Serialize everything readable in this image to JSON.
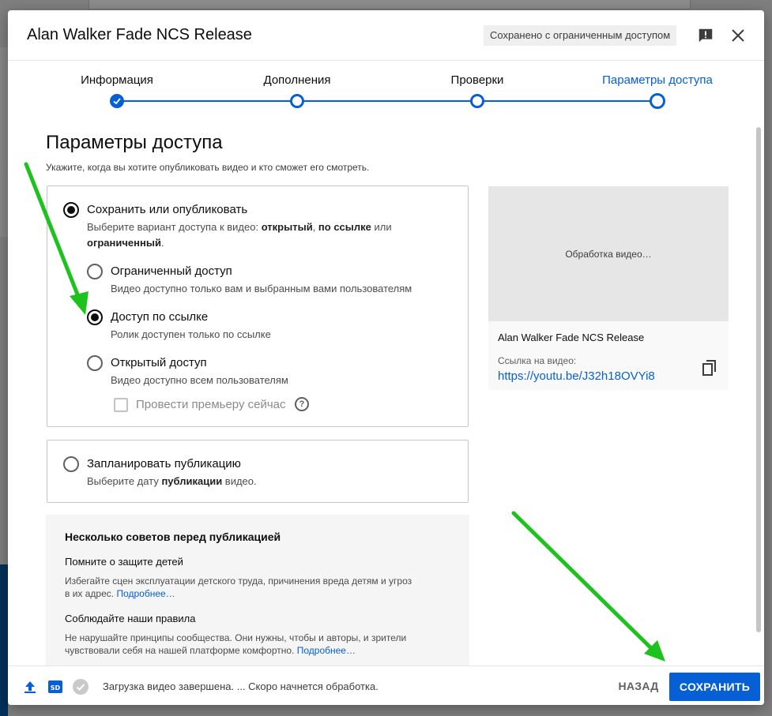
{
  "dialog": {
    "title": "Alan Walker Fade NCS Release",
    "saved_badge": "Сохранено с ограниченным доступом"
  },
  "stepper": {
    "steps": [
      {
        "label": "Информация",
        "state": "done"
      },
      {
        "label": "Дополнения",
        "state": "pending"
      },
      {
        "label": "Проверки",
        "state": "pending"
      },
      {
        "label": "Параметры доступа",
        "state": "active"
      }
    ]
  },
  "visibility": {
    "title": "Параметры доступа",
    "subtitle": "Укажите, когда вы хотите опубликовать видео и кто сможет его смотреть.",
    "save_publish": {
      "label": "Сохранить или опубликовать",
      "desc_prefix": "Выберите вариант доступа к видео: ",
      "desc_b1": "открытый",
      "desc_sep1": ", ",
      "desc_b2": "по ссылке",
      "desc_sep2": " или ",
      "desc_b3": "ограниченный",
      "desc_end": ".",
      "selected": true
    },
    "options": [
      {
        "label": "Ограниченный доступ",
        "desc": "Видео доступно только вам и выбранным вами пользователям",
        "selected": false
      },
      {
        "label": "Доступ по ссылке",
        "desc": "Ролик доступен только по ссылке",
        "selected": true
      },
      {
        "label": "Открытый доступ",
        "desc": "Видео доступно всем пользователям",
        "selected": false
      }
    ],
    "premiere": {
      "label": "Провести премьеру сейчас",
      "checked": false
    },
    "schedule": {
      "label": "Запланировать публикацию",
      "desc_prefix": "Выберите дату ",
      "desc_b": "публикации",
      "desc_end": " видео.",
      "selected": false
    }
  },
  "preview": {
    "processing": "Обработка видео…",
    "name": "Alan Walker Fade NCS Release",
    "link_label": "Ссылка на видео:",
    "link": "https://youtu.be/J32h18OVYi8"
  },
  "tips": {
    "title": "Несколько советов перед публикацией",
    "items": [
      {
        "head": "Помните о защите детей",
        "text": "Избегайте сцен эксплуатации детского труда, причинения вреда детям и угроз в их адрес. ",
        "more": "Подробнее…"
      },
      {
        "head": "Соблюдайте наши правила",
        "text": "Не нарушайте принципы сообщества. Они нужны, чтобы и авторы, и зрители чувствовали себя на нашей платформе комфортно. ",
        "more": "Подробнее…"
      }
    ]
  },
  "footer": {
    "status": "Загрузка видео завершена. ... Скоро начнется обработка.",
    "sd_badge": "SD",
    "back_label": "НАЗАД",
    "save_label": "СОХРАНИТЬ"
  },
  "colors": {
    "accent": "#065fd4",
    "arrow": "#1ec21e"
  }
}
